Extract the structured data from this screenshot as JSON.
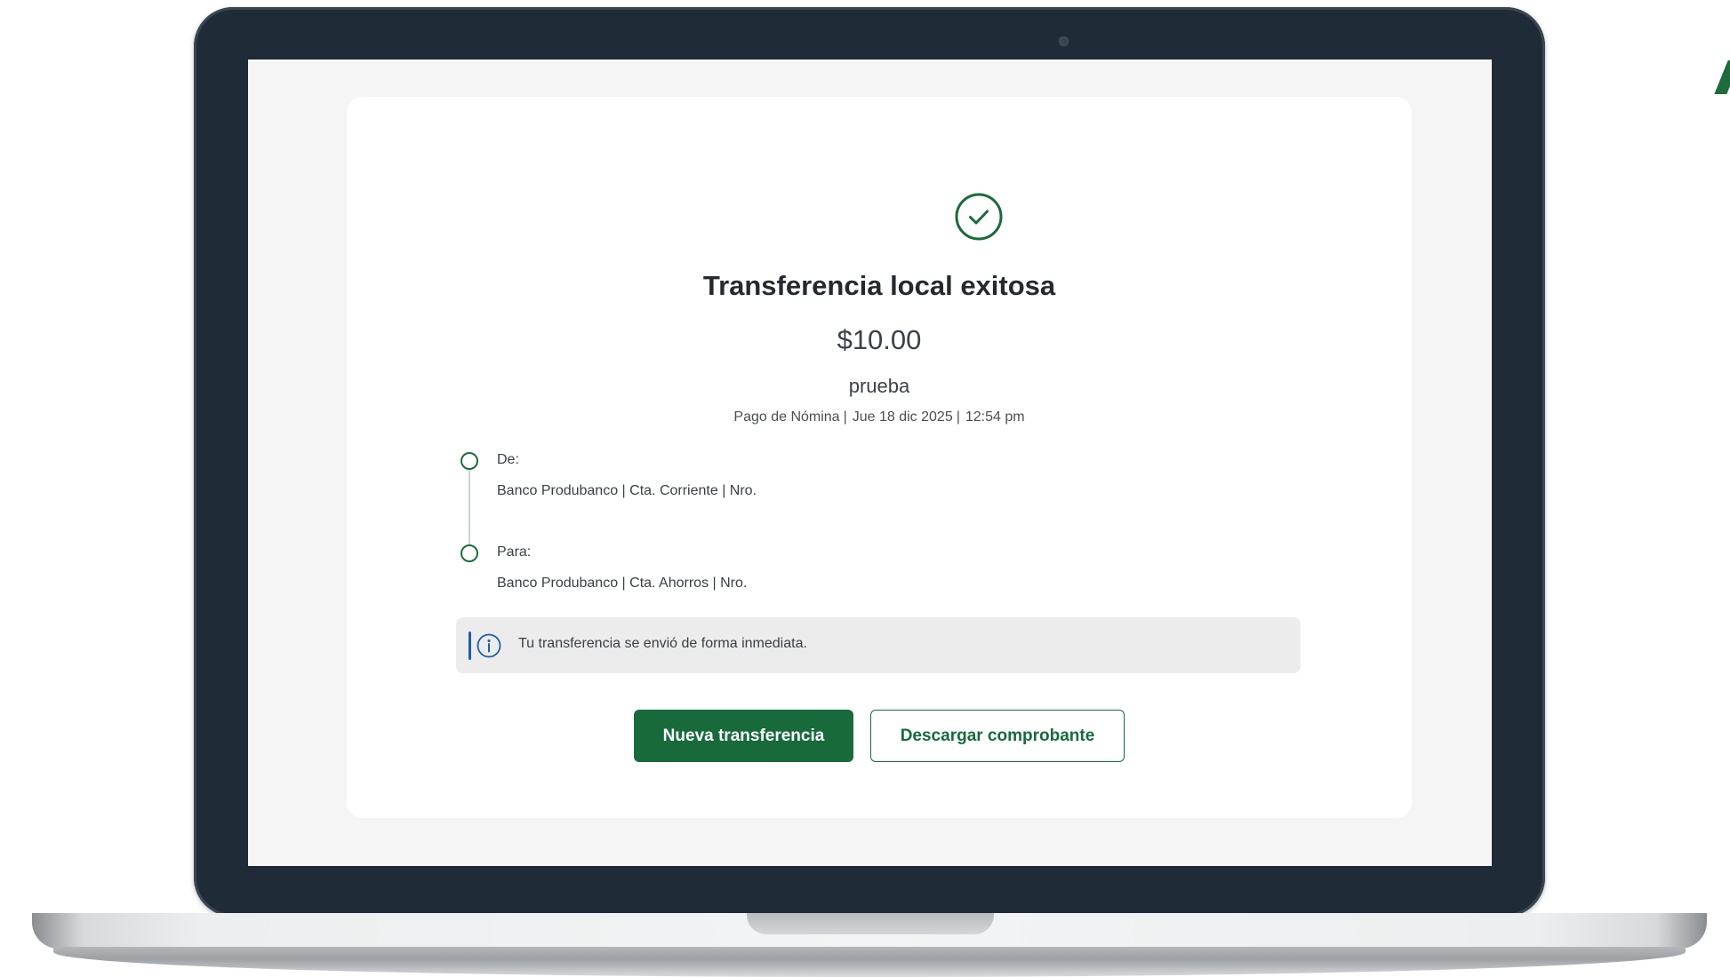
{
  "receipt": {
    "title": "Transferencia local exitosa",
    "amount": "$10.00",
    "description": "prueba",
    "type": "Pago de Nómina",
    "date": "Jue 18 dic 2025",
    "time": "12:54 pm",
    "separator": "|"
  },
  "timeline": {
    "from_label": "De:",
    "from_detail": "Banco Produbanco | Cta. Corriente | Nro.",
    "to_label": "Para:",
    "to_detail": "Banco Produbanco | Cta. Ahorros | Nro."
  },
  "info": {
    "icon": "info-icon",
    "text": "Tu transferencia se envió de forma inmediata."
  },
  "actions": {
    "new_transfer": "Nueva transferencia",
    "download_receipt": "Descargar comprobante"
  },
  "colors": {
    "brand_green": "#186a3b",
    "info_blue": "#1d5ea8",
    "banner_bg": "#ececec",
    "laptop_frame": "#1f2b36"
  },
  "icons": {
    "success": "check-circle-icon",
    "info": "info-icon"
  }
}
